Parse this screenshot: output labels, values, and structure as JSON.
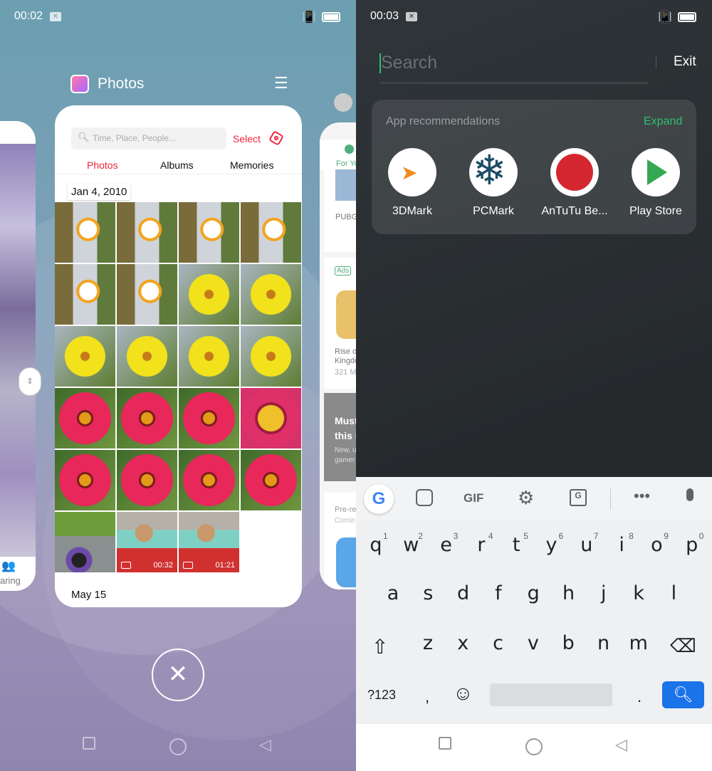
{
  "left": {
    "status": {
      "time": "00:02",
      "notif_icon": "close-box-icon",
      "vibrate_icon": "vibrate-off-icon",
      "battery_icon": "battery-icon"
    },
    "app_title": "Photos",
    "menu_icon": "hamburger-icon",
    "photos_app": {
      "search_placeholder": "Time, Place, People...",
      "select_label": "Select",
      "settings_icon": "hexagon-settings-icon",
      "tabs": [
        {
          "label": "Photos",
          "active": true
        },
        {
          "label": "Albums"
        },
        {
          "label": "Memories"
        }
      ],
      "date_header": "Jan 4, 2010",
      "tiles": [
        "daisy",
        "daisy",
        "daisy",
        "daisy",
        "daisy",
        "daisy",
        "yellow",
        "yellow",
        "yellow",
        "yellow",
        "yellow",
        "yellow",
        "red",
        "red",
        "red",
        "pink",
        "red",
        "red",
        "red",
        "red",
        "bike",
        "video",
        "video"
      ],
      "video_durations": {
        "21": "00:32",
        "22": "01:21"
      },
      "next_date": "May 15"
    },
    "left_card": {
      "tab_label": "aring"
    },
    "right_card": {
      "tab_label": "For Yo",
      "item1": "PUBG",
      "ads_badge": "Ads",
      "item2_line1": "Rise o",
      "item2_line2": "Kingdo",
      "item2_size": "321 M",
      "promo_line1": "Must",
      "promo_line2": "this r",
      "promo_sub1": "New, u",
      "promo_sub2": "gamer",
      "preorder": "Pre-re",
      "coming": "Comin"
    },
    "close_all_icon": "close-icon"
  },
  "right": {
    "status": {
      "time": "00:03",
      "notif_icon": "close-box-icon",
      "vibrate_icon": "vibrate-off-icon",
      "battery_icon": "battery-icon"
    },
    "search_placeholder": "Search",
    "exit_label": "Exit",
    "recommendations": {
      "title": "App recommendations",
      "expand_label": "Expand",
      "apps": [
        {
          "label": "3DMark"
        },
        {
          "label": "PCMark"
        },
        {
          "label": "AnTuTu Be..."
        },
        {
          "label": "Play Store"
        }
      ]
    },
    "keyboard": {
      "toolbar_icons": [
        "google-icon",
        "sticker-icon",
        "gif-icon",
        "settings-icon",
        "translate-icon",
        "more-icon",
        "mic-icon"
      ],
      "gif_label": "GIF",
      "row1": [
        "q",
        "w",
        "e",
        "r",
        "t",
        "y",
        "u",
        "i",
        "o",
        "p"
      ],
      "row1_hints": [
        "1",
        "2",
        "3",
        "4",
        "5",
        "6",
        "7",
        "8",
        "9",
        "0"
      ],
      "row2": [
        "a",
        "s",
        "d",
        "f",
        "g",
        "h",
        "j",
        "k",
        "l"
      ],
      "row3": [
        "z",
        "x",
        "c",
        "v",
        "b",
        "n",
        "m"
      ],
      "symbols_label": "?123",
      "comma": ",",
      "period": "."
    }
  },
  "colors": {
    "accent_red": "#f0243c",
    "accent_green": "#2fbf71",
    "search_blue": "#1a73e8"
  }
}
